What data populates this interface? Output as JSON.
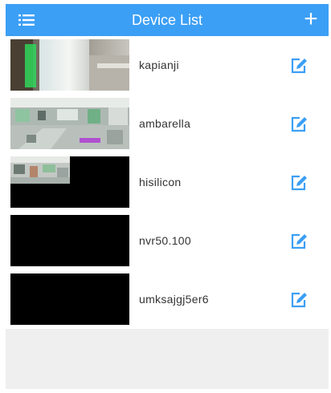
{
  "header": {
    "title": "Device List",
    "menu_icon": "list-menu-icon",
    "add_label": "+",
    "accent_color": "#3b9ff5"
  },
  "devices": [
    {
      "name": "kapianji",
      "thumbnail": "camera-preview-frame",
      "edit_icon": "edit-icon"
    },
    {
      "name": "ambarella",
      "thumbnail": "camera-preview-frame",
      "edit_icon": "edit-icon"
    },
    {
      "name": "hisilicon",
      "thumbnail": "camera-preview-frame",
      "edit_icon": "edit-icon"
    },
    {
      "name": "nvr50.100",
      "thumbnail": "black-frame",
      "edit_icon": "edit-icon"
    },
    {
      "name": "umksajgj5er6",
      "thumbnail": "black-frame",
      "edit_icon": "edit-icon"
    }
  ]
}
